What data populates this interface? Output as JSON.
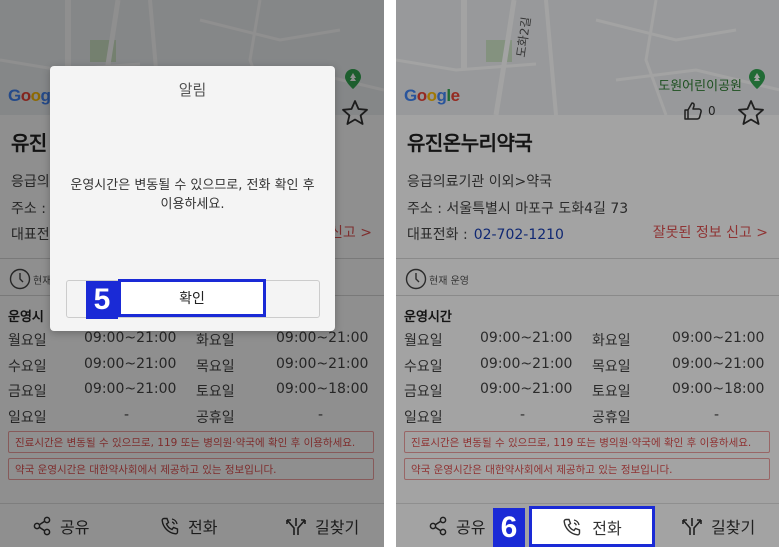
{
  "map": {
    "road_label": "도화2길",
    "park_label": "도원어린이공원",
    "google_letters": [
      "G",
      "o",
      "o",
      "g",
      "l",
      "e"
    ],
    "google_colors": [
      "#4285F4",
      "#EA4335",
      "#FBBC05",
      "#4285F4",
      "#34A853",
      "#EA4335"
    ]
  },
  "place": {
    "name": "유진온누리약국",
    "name_truncated": "유진",
    "category": "응급의료기관 이외>약국",
    "category_truncated": "응급의",
    "address": "주소 : 서울특별시 마포구 도화4길 73",
    "address_truncated": "주소 :",
    "tel_label": "대표전화 :",
    "tel_label_truncated": "대표전",
    "tel_number": "02-702-1210",
    "report_link": "잘못된 정보 신고 >",
    "report_link_truncated": "신고 >",
    "like_count": "0"
  },
  "status": {
    "label": "현재 운영",
    "label_truncated": "현재"
  },
  "hours": {
    "title": "운영시간",
    "title_truncated": "운영시",
    "rows": [
      {
        "d1": "월요일",
        "t1": "09:00~21:00",
        "d2": "화요일",
        "t2": "09:00~21:00"
      },
      {
        "d1": "수요일",
        "t1": "09:00~21:00",
        "d2": "목요일",
        "t2": "09:00~21:00"
      },
      {
        "d1": "금요일",
        "t1": "09:00~21:00",
        "d2": "토요일",
        "t2": "09:00~18:00"
      },
      {
        "d1": "일요일",
        "t1": "-",
        "d2": "공휴일",
        "t2": "-"
      }
    ]
  },
  "notices": {
    "n1": "진료시간은 변동될 수 있으므로, 119 또는 병의원·약국에 확인 후 이용하세요.",
    "n2": "약국 운영시간은 대한약사회에서 제공하고 있는 정보입니다."
  },
  "bottom_bar": {
    "share": "공유",
    "call": "전화",
    "route": "길찾기"
  },
  "dialog": {
    "title": "알림",
    "message": "운영시간은 변동될 수 있으므로, 전화 확인 후 이용하세요.",
    "ok": "확인"
  },
  "steps": {
    "step5": "5",
    "step6": "6"
  },
  "colors": {
    "highlight": "#1a2ad6",
    "tel": "#1a3fb4",
    "alert": "#e05252"
  }
}
